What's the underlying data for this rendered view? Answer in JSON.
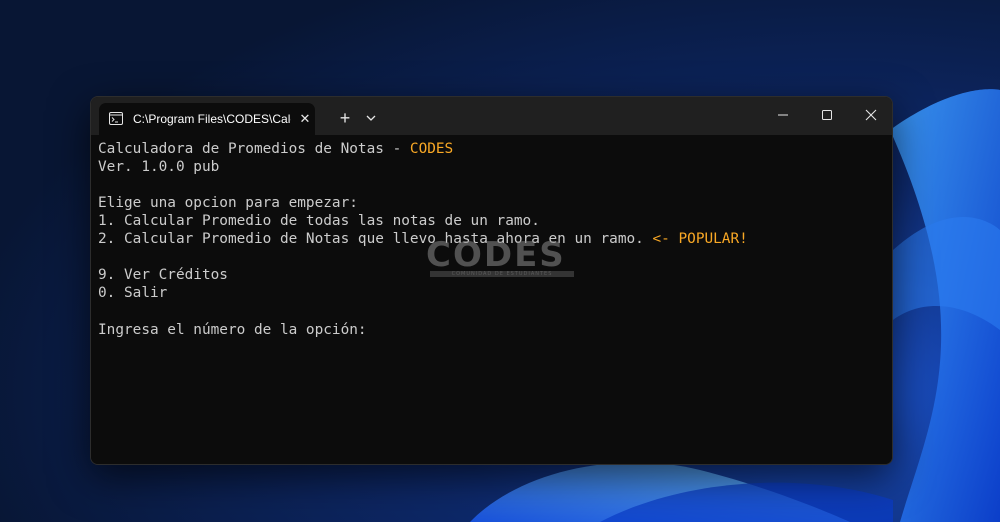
{
  "window": {
    "tab_title": "C:\\Program Files\\CODES\\Calcu",
    "tab_icon": "terminal-icon",
    "new_tab_glyph": "+",
    "close_tab_glyph": "✕"
  },
  "terminal": {
    "lines": [
      {
        "text": "Calculadora de Promedios de Notas - ",
        "highlight": "CODES"
      },
      {
        "text": "Ver. 1.0.0 pub",
        "highlight": ""
      },
      {
        "text": "",
        "highlight": ""
      },
      {
        "text": "Elige una opcion para empezar:",
        "highlight": ""
      },
      {
        "text": "1. Calcular Promedio de todas las notas de un ramo.",
        "highlight": ""
      },
      {
        "text": "2. Calcular Promedio de Notas que llevo hasta ahora en un ramo. ",
        "highlight": "<- POPULAR!"
      },
      {
        "text": "",
        "highlight": ""
      },
      {
        "text": "9. Ver Créditos",
        "highlight": ""
      },
      {
        "text": "0. Salir",
        "highlight": ""
      },
      {
        "text": "",
        "highlight": ""
      },
      {
        "text": "Ingresa el número de la opción:",
        "highlight": ""
      }
    ]
  },
  "watermark": {
    "logo": "CODES",
    "subtitle": "COMUNIDAD DE ESTUDIANTES"
  },
  "colors": {
    "highlight": "#f9a825",
    "terminal_text": "#cccccc",
    "terminal_bg": "#0c0c0c",
    "titlebar_bg": "#202020"
  }
}
